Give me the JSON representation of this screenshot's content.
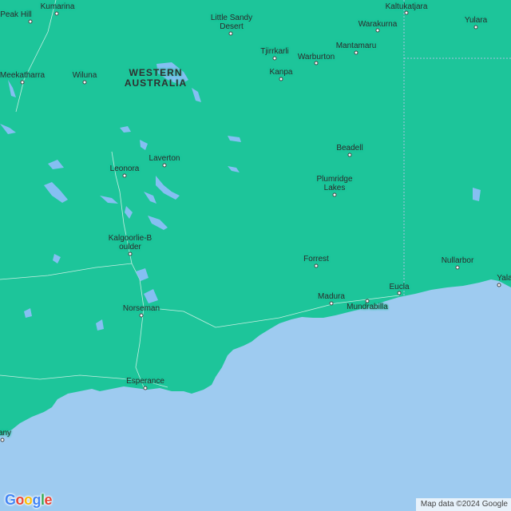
{
  "map": {
    "colors": {
      "land": "#1dc59a",
      "sea": "#9ecbf0",
      "lake": "#85bff2",
      "border": "#a8c9e8",
      "road": "#e8e8e8"
    },
    "region_label": [
      "WESTERN",
      "AUSTRALIA"
    ],
    "places": [
      {
        "name": "Peak Hill"
      },
      {
        "name": "Kumarina"
      },
      {
        "name": "Little Sandy Desert"
      },
      {
        "name": "Kaltukatjara"
      },
      {
        "name": "Warakurna"
      },
      {
        "name": "Yulara"
      },
      {
        "name": "Tjirrkarli"
      },
      {
        "name": "Mantamaru"
      },
      {
        "name": "Warburton"
      },
      {
        "name": "Meekatharra"
      },
      {
        "name": "Wiluna"
      },
      {
        "name": "Kanpa"
      },
      {
        "name": "Beadell"
      },
      {
        "name": "Laverton"
      },
      {
        "name": "Leonora"
      },
      {
        "name": "Plumridge Lakes"
      },
      {
        "name": "Kalgoorlie-Boulder"
      },
      {
        "name": "Forrest"
      },
      {
        "name": "Nullarbor"
      },
      {
        "name": "Yala"
      },
      {
        "name": "Eucla"
      },
      {
        "name": "Madura"
      },
      {
        "name": "Mundrabilla"
      },
      {
        "name": "Norseman"
      },
      {
        "name": "Esperance"
      },
      {
        "name": "any"
      }
    ]
  },
  "logo": {
    "letters": [
      "G",
      "o",
      "o",
      "g",
      "l",
      "e"
    ]
  },
  "attribution": "Map data ©2024 Google"
}
